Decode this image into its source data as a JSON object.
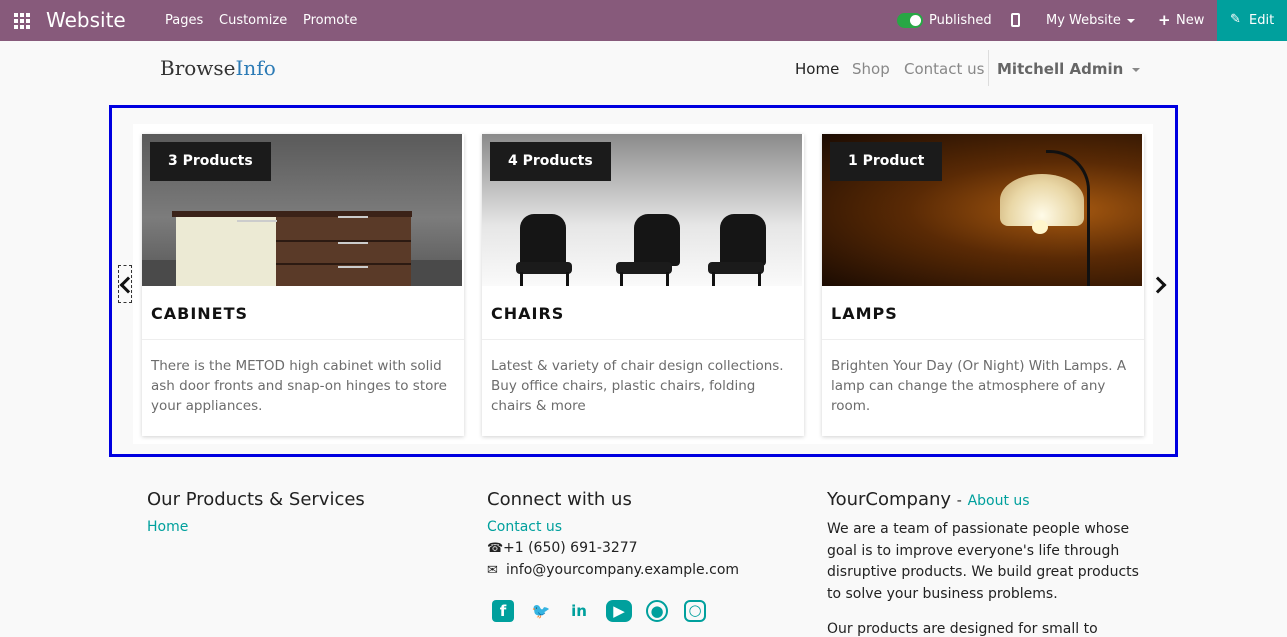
{
  "topbar": {
    "app_title": "Website",
    "menu": [
      "Pages",
      "Customize",
      "Promote"
    ],
    "published_label": "Published",
    "site_selector": "My Website",
    "new_label": "New",
    "edit_label": "Edit"
  },
  "site": {
    "brand_part1": "Browse",
    "brand_part2": "Info",
    "nav": [
      "Home",
      "Shop",
      "Contact us"
    ],
    "user": "Mitchell Admin"
  },
  "carousel": {
    "cards": [
      {
        "badge": "3 Products",
        "title": "CABINETS",
        "description": "There is the METOD high cabinet with solid ash door fronts and snap-on hinges to store your appliances."
      },
      {
        "badge": "4 Products",
        "title": "CHAIRS",
        "description": "Latest & variety of chair design collections. Buy office chairs, plastic chairs, folding chairs & more"
      },
      {
        "badge": "1 Product",
        "title": "LAMPS",
        "description": "Brighten Your Day (Or Night) With Lamps. A lamp can change the atmosphere of any room."
      }
    ]
  },
  "footer": {
    "products_heading": "Our Products & Services",
    "products_home": "Home",
    "connect_heading": "Connect with us",
    "contact_link": "Contact us",
    "phone": "+1 (650) 691-3277",
    "email": "info@yourcompany.example.com",
    "company_heading": "YourCompany",
    "company_sep": "-",
    "about_link": "About us",
    "about_text_1": "We are a team of passionate people whose goal is to improve everyone's life through disruptive products. We build great products to solve your business problems.",
    "about_text_2": "Our products are designed for small to",
    "social": [
      "facebook-icon",
      "twitter-icon",
      "linkedin-icon",
      "youtube-icon",
      "github-icon",
      "instagram-icon"
    ]
  },
  "colors": {
    "topbar": "#875a7b",
    "accent": "#00a09d",
    "highlight_frame": "#0000e0"
  }
}
